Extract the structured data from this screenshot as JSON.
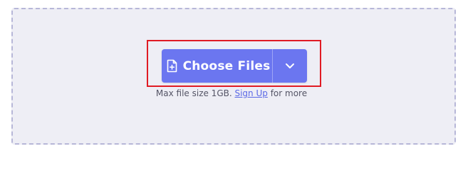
{
  "upload": {
    "choose_label": "Choose Files",
    "hint_prefix": "Max file size 1GB. ",
    "hint_link": "Sign Up",
    "hint_suffix": " for more",
    "file_icon": "file-plus-icon",
    "dropdown_icon": "chevron-down-icon"
  },
  "colors": {
    "button": "#6b76f0",
    "dropzone_bg": "#eeeef5",
    "dropzone_border": "#b7b7d8",
    "highlight": "#e01b24",
    "link": "#5b69e6"
  }
}
